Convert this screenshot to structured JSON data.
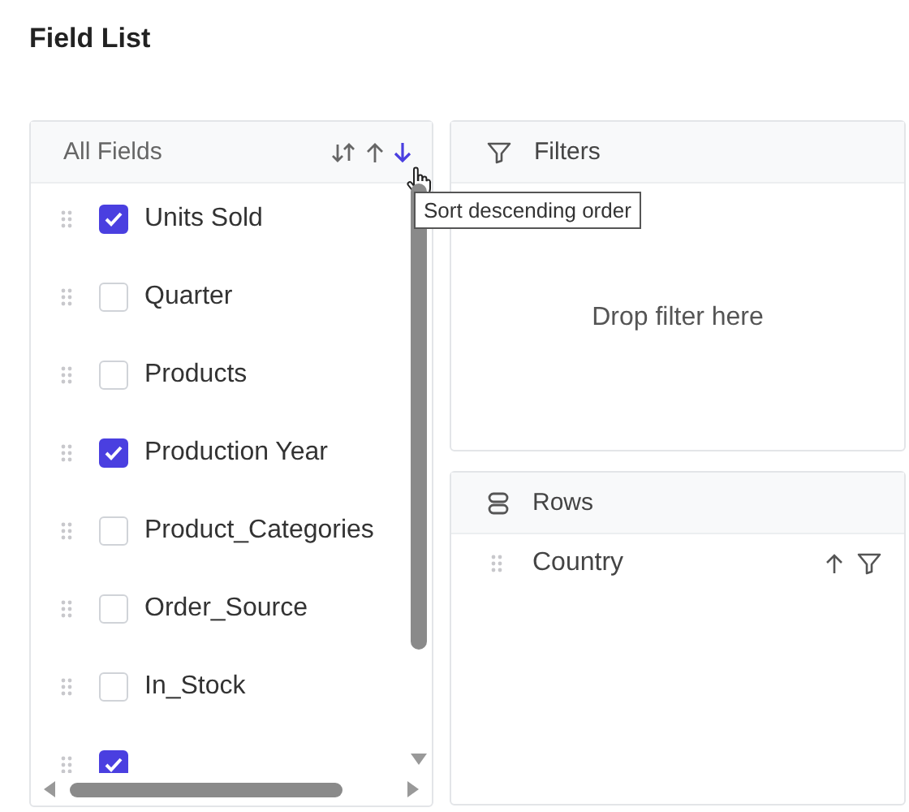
{
  "title": "Field List",
  "all_fields": {
    "header": "All Fields",
    "sort_buttons": [
      {
        "kind": "both",
        "selected": false
      },
      {
        "kind": "ascending",
        "selected": false
      },
      {
        "kind": "descending",
        "selected": true
      }
    ],
    "tooltip": "Sort descending order",
    "items": [
      {
        "label": "Units Sold",
        "checked": true
      },
      {
        "label": "Quarter",
        "checked": false
      },
      {
        "label": "Products",
        "checked": false
      },
      {
        "label": "Production Year",
        "checked": true
      },
      {
        "label": "Product_Categories",
        "checked": false
      },
      {
        "label": "Order_Source",
        "checked": false
      },
      {
        "label": "In_Stock",
        "checked": false
      },
      {
        "checked": true
      }
    ]
  },
  "filters": {
    "header": "Filters",
    "placeholder": "Drop filter here"
  },
  "rows": {
    "header": "Rows",
    "items": [
      {
        "label": "Country"
      }
    ]
  }
}
